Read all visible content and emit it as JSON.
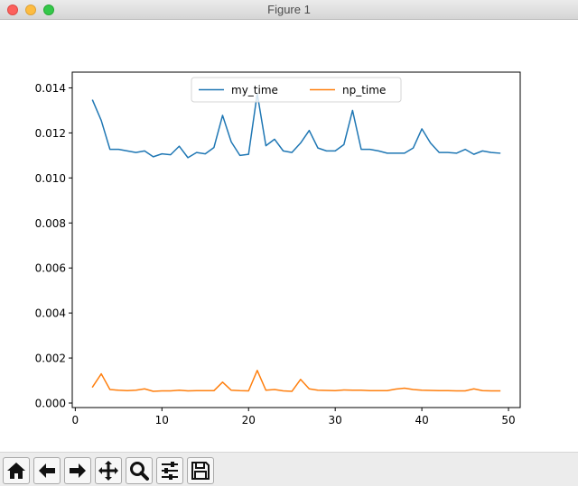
{
  "window": {
    "title": "Figure 1"
  },
  "toolbar": {
    "buttons": [
      {
        "name": "home-button",
        "icon": "home-icon"
      },
      {
        "name": "back-button",
        "icon": "arrow-left-icon"
      },
      {
        "name": "forward-button",
        "icon": "arrow-right-icon"
      },
      {
        "name": "pan-button",
        "icon": "move-icon"
      },
      {
        "name": "zoom-button",
        "icon": "magnifier-icon"
      },
      {
        "name": "configure-subplots-button",
        "icon": "sliders-icon"
      },
      {
        "name": "save-button",
        "icon": "floppy-disk-icon"
      }
    ]
  },
  "chart_data": {
    "type": "line",
    "title": "",
    "xlabel": "",
    "ylabel": "",
    "xlim": [
      -0.35,
      51.35
    ],
    "ylim": [
      -0.0002,
      0.0147
    ],
    "xticks": [
      0,
      10,
      20,
      30,
      40,
      50
    ],
    "yticks": [
      0.0,
      0.002,
      0.004,
      0.006,
      0.008,
      0.01,
      0.012,
      0.014
    ],
    "ytick_labels": [
      "0.000",
      "0.002",
      "0.004",
      "0.006",
      "0.008",
      "0.010",
      "0.012",
      "0.014"
    ],
    "grid": false,
    "legend": {
      "placement": "upper-center",
      "columns": 2
    },
    "x": [
      2,
      3,
      4,
      5,
      6,
      7,
      8,
      9,
      10,
      11,
      12,
      13,
      14,
      15,
      16,
      17,
      18,
      19,
      20,
      21,
      22,
      23,
      24,
      25,
      26,
      27,
      28,
      29,
      30,
      31,
      32,
      33,
      34,
      35,
      36,
      37,
      38,
      39,
      40,
      41,
      42,
      43,
      44,
      45,
      46,
      47,
      48,
      49
    ],
    "series": [
      {
        "name": "my_time",
        "color": "#1f77b4",
        "values": [
          0.01345,
          0.01255,
          0.01127,
          0.01127,
          0.0112,
          0.01113,
          0.0112,
          0.01094,
          0.01107,
          0.01103,
          0.01141,
          0.0109,
          0.01113,
          0.01107,
          0.01135,
          0.01278,
          0.0116,
          0.011,
          0.01105,
          0.01375,
          0.01143,
          0.01172,
          0.0112,
          0.01113,
          0.01155,
          0.01211,
          0.01133,
          0.0112,
          0.0112,
          0.01148,
          0.013,
          0.01127,
          0.01127,
          0.0112,
          0.0111,
          0.0111,
          0.0111,
          0.01133,
          0.01218,
          0.01155,
          0.01113,
          0.01113,
          0.0111,
          0.01127,
          0.01105,
          0.0112,
          0.01113,
          0.0111
        ]
      },
      {
        "name": "np_time",
        "color": "#ff7f0e",
        "values": [
          0.00072,
          0.0013,
          0.0006,
          0.00057,
          0.00055,
          0.00057,
          0.00063,
          0.00052,
          0.00054,
          0.00054,
          0.00057,
          0.00054,
          0.00055,
          0.00055,
          0.00055,
          0.00093,
          0.00057,
          0.00055,
          0.00054,
          0.00145,
          0.00057,
          0.0006,
          0.00054,
          0.00052,
          0.00105,
          0.00063,
          0.00057,
          0.00056,
          0.00055,
          0.00058,
          0.00057,
          0.00057,
          0.00055,
          0.00055,
          0.00055,
          0.00062,
          0.00066,
          0.0006,
          0.00057,
          0.00056,
          0.00055,
          0.00055,
          0.00054,
          0.00054,
          0.00063,
          0.00055,
          0.00054,
          0.00054
        ]
      }
    ]
  }
}
